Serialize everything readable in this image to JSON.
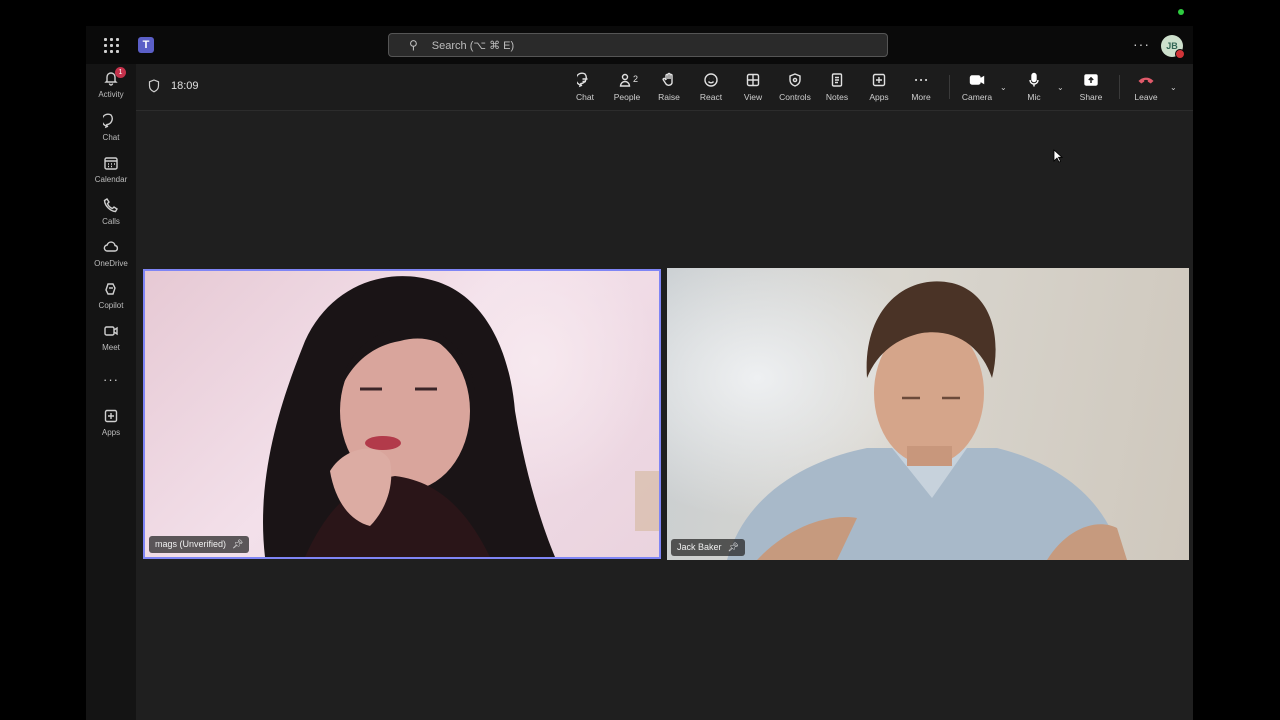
{
  "titlebar": {
    "search_placeholder": "Search (⌥ ⌘ E)",
    "avatar_initials": "JB",
    "more": "···"
  },
  "sidebar": {
    "items": [
      {
        "label": "Activity",
        "badge": "1",
        "icon": "bell-icon"
      },
      {
        "label": "Chat",
        "icon": "chat-icon"
      },
      {
        "label": "Calendar",
        "icon": "calendar-icon"
      },
      {
        "label": "Calls",
        "icon": "phone-icon"
      },
      {
        "label": "OneDrive",
        "icon": "cloud-icon"
      },
      {
        "label": "Copilot",
        "icon": "copilot-icon"
      },
      {
        "label": "Meet",
        "icon": "video-icon"
      },
      {
        "label": "Apps",
        "icon": "add-app-icon"
      }
    ],
    "more": "···"
  },
  "meeting": {
    "timer": "18:09",
    "people_count": "2",
    "toolbar": [
      {
        "label": "Chat",
        "icon": "chat-icon"
      },
      {
        "label": "People",
        "icon": "people-icon"
      },
      {
        "label": "Raise",
        "icon": "hand-icon"
      },
      {
        "label": "React",
        "icon": "smile-icon"
      },
      {
        "label": "View",
        "icon": "grid-view-icon"
      },
      {
        "label": "Controls",
        "icon": "controls-icon"
      },
      {
        "label": "Notes",
        "icon": "notes-icon"
      },
      {
        "label": "Apps",
        "icon": "add-app-icon"
      },
      {
        "label": "More",
        "icon": "more-icon"
      },
      {
        "label": "Camera",
        "icon": "camera-icon"
      },
      {
        "label": "Mic",
        "icon": "mic-icon"
      },
      {
        "label": "Share",
        "icon": "share-icon"
      },
      {
        "label": "Leave",
        "icon": "hangup-icon"
      }
    ]
  },
  "participants": [
    {
      "name": "mags (Unverified)"
    },
    {
      "name": "Jack Baker"
    }
  ],
  "colors": {
    "accent": "#7f85f5",
    "leave": "#e05a6a",
    "badge": "#c4314b",
    "background": "#1f1f1f"
  }
}
